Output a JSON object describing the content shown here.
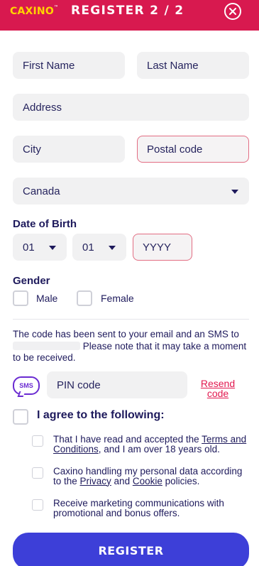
{
  "header": {
    "logo_main": "CAXINO",
    "logo_tm": "™",
    "title": "REGISTER  2 / 2"
  },
  "form": {
    "first_name_placeholder": "First Name",
    "last_name_placeholder": "Last Name",
    "address_placeholder": "Address",
    "city_placeholder": "City",
    "postal_code_placeholder": "Postal code",
    "country_value": "Canada",
    "dob_label": "Date of Birth",
    "dob_day_value": "01",
    "dob_month_value": "01",
    "dob_year_placeholder": "YYYY",
    "gender_label": "Gender",
    "gender_male": "Male",
    "gender_female": "Female"
  },
  "verification": {
    "message_part1": "The code has been sent to your email and an SMS to",
    "message_part2": "Please note that it may take a moment to be received.",
    "sms_badge": "SMS",
    "pin_placeholder": "PIN code",
    "resend_line1": "Resend",
    "resend_line2": "code"
  },
  "terms": {
    "agree_label": "I agree to the following:",
    "item1_pre": "That I have read and accepted the ",
    "item1_link": "Terms and Conditions",
    "item1_post": ", and I am over 18 years old.",
    "item2_pre": "Caxino handling my personal data according to the ",
    "item2_link1": "Privacy",
    "item2_mid": " and ",
    "item2_link2": "Cookie",
    "item2_post": " policies.",
    "item3": "Receive marketing communications with promotional and bonus offers."
  },
  "actions": {
    "register_label": "REGISTER"
  },
  "colors": {
    "header_bg": "#d8194f",
    "button_bg": "#3d3fd8",
    "error_border": "#e26d83",
    "link": "#e2184f"
  },
  "icons": {
    "close": "close-circle-icon",
    "dropdown": "chevron-down-icon",
    "sms": "sms-bubble-icon"
  }
}
